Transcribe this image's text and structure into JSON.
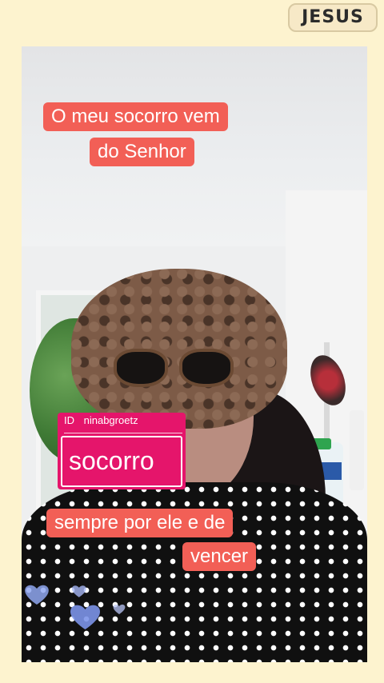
{
  "watermark": {
    "text": "JESUS"
  },
  "captions": {
    "top_line1": "O meu socorro vem",
    "top_line2": "do Senhor",
    "bottom_line1": "sempre por ele e de",
    "bottom_line2": "vencer"
  },
  "sticker": {
    "id_label": "ID",
    "username": "ninabgroetz",
    "word": "socorro"
  },
  "colors": {
    "background": "#fdf3cf",
    "caption_bg": "#f25f56",
    "sticker_bg": "#e5156b",
    "text": "#ffffff"
  },
  "icons": [
    "heart-icon"
  ]
}
